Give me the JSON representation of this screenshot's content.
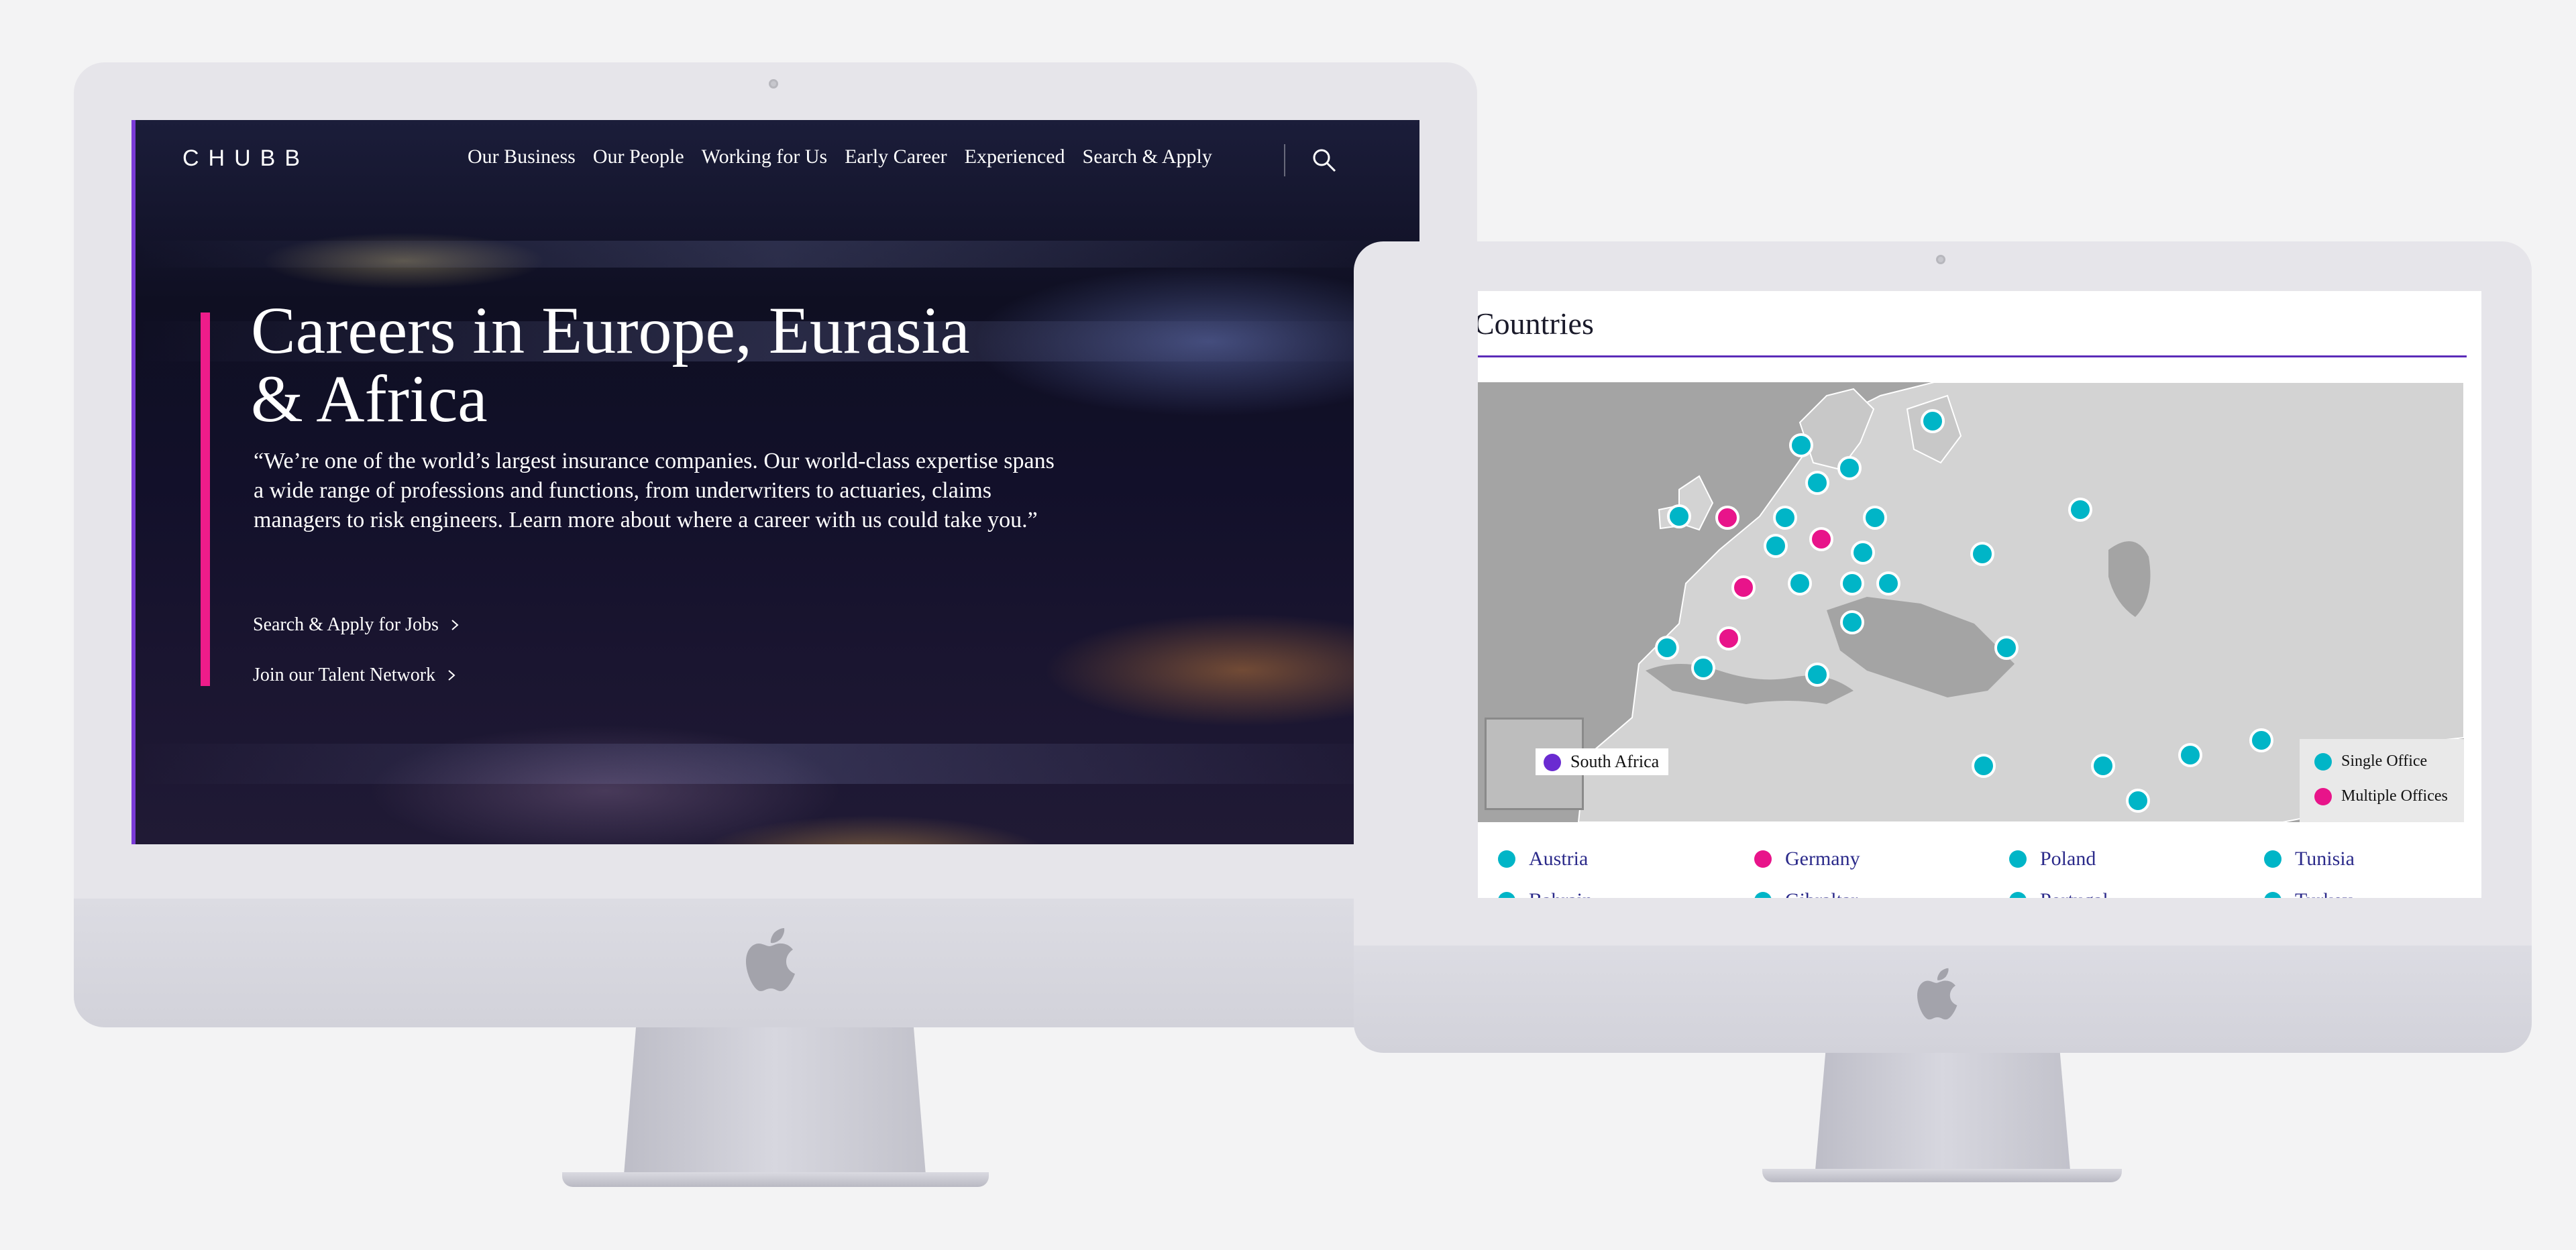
{
  "left_screen": {
    "brand": "CHUBB",
    "nav": [
      "Our Business",
      "Our People",
      "Working for Us",
      "Early Career",
      "Experienced",
      "Search & Apply"
    ],
    "hero": {
      "title_line1": "Careers in Europe, Eurasia",
      "title_line2": "& Africa",
      "quote_line1": "“We’re one of the world’s largest insurance companies. Our world-class expertise spans",
      "quote_line2": "a wide range of professions and functions, from underwriters to actuaries, claims",
      "quote_line3": "managers to risk engineers. Learn more about where a career with us could take you.”",
      "cta1": "Search & Apply for Jobs",
      "cta2": "Join our Talent Network"
    }
  },
  "right_screen": {
    "section_title": "Countries",
    "inset_label": "South Africa",
    "legend": {
      "single": "Single Office",
      "multiple": "Multiple Offices"
    },
    "colors": {
      "single": "#00b5c7",
      "multiple": "#e8148a",
      "inset": "#6a2bd1",
      "accent": "#5b2bb8"
    },
    "countries_row1": [
      {
        "name": "Austria",
        "type": "single"
      },
      {
        "name": "Germany",
        "type": "multiple"
      },
      {
        "name": "Poland",
        "type": "single"
      },
      {
        "name": "Tunisia",
        "type": "single"
      }
    ],
    "countries_row2": [
      {
        "name": "Bahrain",
        "type": "single"
      },
      {
        "name": "Gibraltar",
        "type": "single"
      },
      {
        "name": "Portugal",
        "type": "single"
      },
      {
        "name": "Turkey",
        "type": "single"
      }
    ]
  }
}
